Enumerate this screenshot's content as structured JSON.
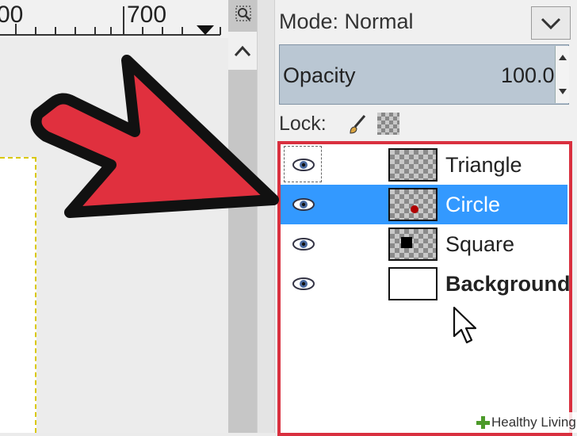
{
  "ruler": {
    "label_left": "00",
    "label_mid": "700"
  },
  "layers_panel": {
    "mode_label": "Mode: Normal",
    "opacity_label": "Opacity",
    "opacity_value": "100.0",
    "lock_label": "Lock:",
    "layers": [
      {
        "name": "Triangle",
        "selected": false,
        "thumb": "transparent-triangle"
      },
      {
        "name": "Circle",
        "selected": true,
        "thumb": "transparent-red-dot"
      },
      {
        "name": "Square",
        "selected": false,
        "thumb": "transparent-black-square"
      },
      {
        "name": "Background",
        "selected": false,
        "thumb": "white",
        "bold": true
      }
    ]
  },
  "overlay": {
    "arrow_color": "#e0303e",
    "highlight_color": "#d9303f",
    "pointer": "mouse-pointer-icon"
  },
  "watermark": {
    "text": "Healthy Living"
  }
}
